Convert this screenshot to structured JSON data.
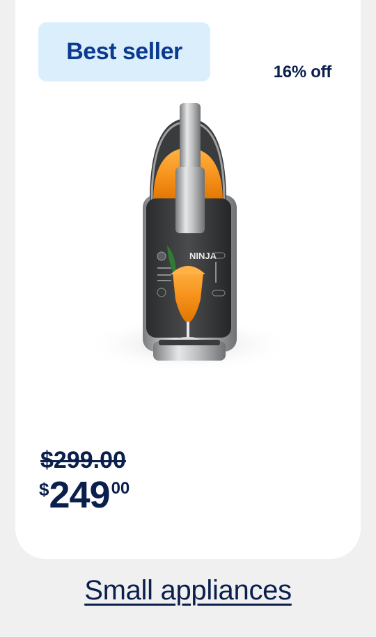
{
  "product_card": {
    "badge_label": "Best seller",
    "discount_label": "16% off",
    "image_alt": "Ninja slushie machine with orange drink",
    "brand_on_device": "NINJA",
    "was_price": "$299.00",
    "now_price": {
      "currency": "$",
      "dollars": "249",
      "cents": "00"
    }
  },
  "category_link": {
    "label": "Small appliances"
  },
  "colors": {
    "page_bg": "#f0f0f0",
    "card_bg": "#ffffff",
    "badge_bg": "#dbeefc",
    "badge_text": "#0b3a8f",
    "text_navy": "#0b1f4d",
    "drink_orange": "#f7941d"
  }
}
